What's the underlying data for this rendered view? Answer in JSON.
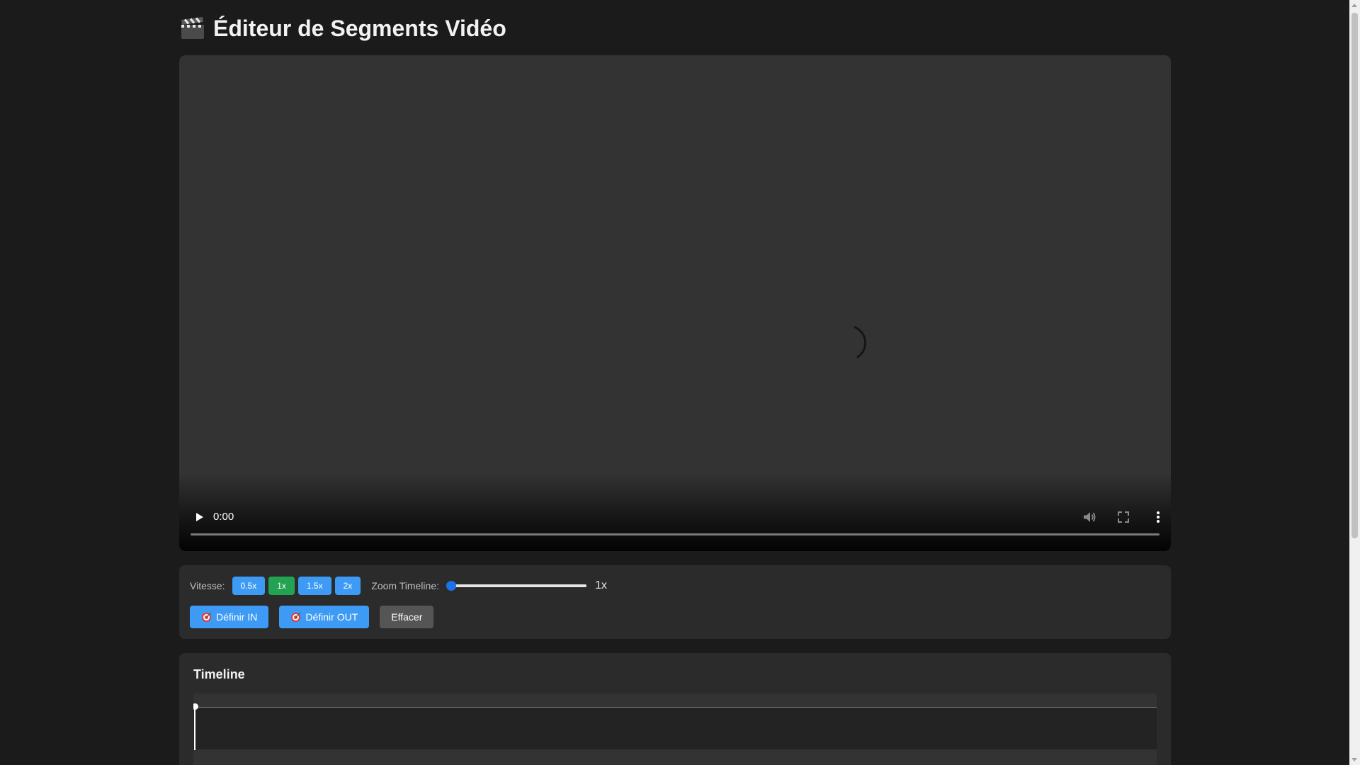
{
  "page": {
    "title": "Éditeur de Segments Vidéo",
    "title_icon": "clapperboard-icon"
  },
  "video": {
    "current_time": "0:00",
    "progress": 0,
    "state": "loading",
    "icons": [
      "play-icon",
      "volume-icon",
      "fullscreen-icon",
      "more-options-icon"
    ]
  },
  "controls": {
    "speed_label": "Vitesse:",
    "speeds": [
      {
        "label": "0.5x",
        "active": false
      },
      {
        "label": "1x",
        "active": true
      },
      {
        "label": "1.5x",
        "active": false
      },
      {
        "label": "2x",
        "active": false
      }
    ],
    "zoom_label": "Zoom Timeline:",
    "zoom_value": "1x",
    "zoom_level": 0,
    "set_in_label": "Définir IN",
    "set_out_label": "Définir OUT",
    "clear_label": "Effacer"
  },
  "timeline": {
    "title": "Timeline",
    "playhead_position": 0
  },
  "colors": {
    "accent_blue": "#3d9bf5",
    "active_green": "#23a352",
    "neutral_button": "#555555",
    "background": "#1b1b1b",
    "panel": "#2b2b2b"
  }
}
